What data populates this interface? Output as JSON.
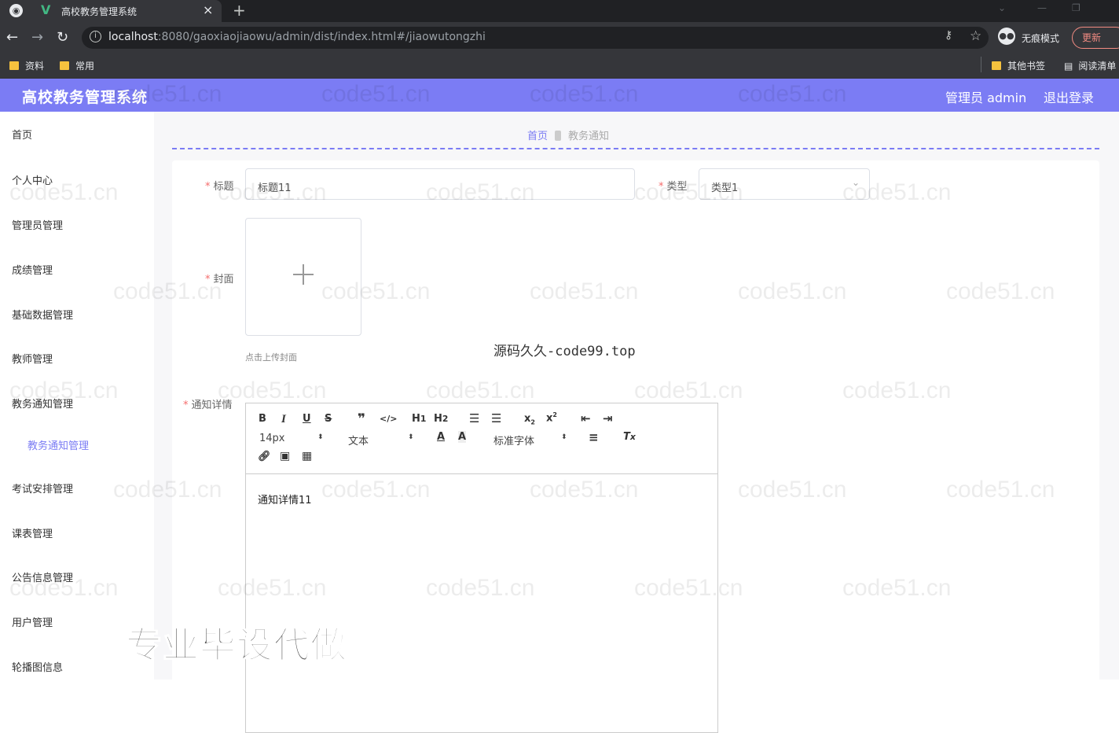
{
  "browser": {
    "tab_title": "高校教务管理系统",
    "url_host": "localhost",
    "url_path": ":8080/gaoxiaojiaowu/admin/dist/index.html#/jiaowutongzhi",
    "incognito_label": "无痕模式",
    "update_label": "更新",
    "bookmarks": [
      "资料",
      "常用"
    ],
    "other_bookmarks": "其他书签",
    "reading_list": "阅读清单"
  },
  "header": {
    "app_title": "高校教务管理系统",
    "admin_label": "管理员 admin",
    "logout": "退出登录"
  },
  "sidebar": {
    "items": [
      {
        "label": "首页"
      },
      {
        "label": "个人中心"
      },
      {
        "label": "管理员管理"
      },
      {
        "label": "成绩管理"
      },
      {
        "label": "基础数据管理"
      },
      {
        "label": "教师管理"
      },
      {
        "label": "教务通知管理"
      },
      {
        "label": "教务通知管理"
      },
      {
        "label": "考试安排管理"
      },
      {
        "label": "课表管理"
      },
      {
        "label": "公告信息管理"
      },
      {
        "label": "用户管理"
      },
      {
        "label": "轮播图信息"
      }
    ]
  },
  "breadcrumb": {
    "home": "首页",
    "current": "教务通知"
  },
  "form": {
    "title_label": "标题",
    "title_value": "标题11",
    "type_label": "类型",
    "type_value": "类型1",
    "cover_label": "封面",
    "cover_hint": "点击上传封面",
    "detail_label": "通知详情",
    "detail_value": "通知详情11"
  },
  "editor": {
    "font_size": "14px",
    "text_style": "文本",
    "font_family": "标准字体"
  },
  "overlay": {
    "watermark": "code51.cn",
    "site_text": "源码久久-code99.top",
    "promo_text": "专业毕设代做"
  }
}
